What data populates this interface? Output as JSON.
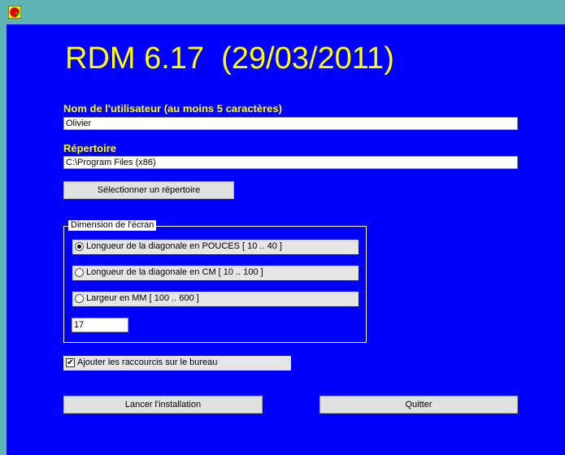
{
  "window": {
    "icon": "app-icon",
    "title": "RDM 6.17  (29/03/2011)"
  },
  "user": {
    "label": "Nom de l'utilisateur (au moins 5 caractères)",
    "value": "Olivier"
  },
  "directory": {
    "label": "Répertoire",
    "value": "C:\\Program Files (x86)",
    "select_button": "Sélectionner un répertoire"
  },
  "screen": {
    "legend": "Dimension de l'écran",
    "options": [
      {
        "label": "Longueur de la diagonale en POUCES [ 10 .. 40 ]",
        "selected": true
      },
      {
        "label": "Longueur de la diagonale en CM [ 10 .. 100 ]",
        "selected": false
      },
      {
        "label": "Largeur en MM [ 100 .. 600 ]",
        "selected": false
      }
    ],
    "value": "17"
  },
  "shortcuts": {
    "label": "Ajouter les raccourcis sur le bureau",
    "checked": true,
    "check_glyph": "✔"
  },
  "actions": {
    "install": "Lancer l'installation",
    "quit": "Quitter"
  },
  "colors": {
    "background": "#0000ff",
    "title": "#ffff00",
    "frame": "#5fb3b3"
  }
}
